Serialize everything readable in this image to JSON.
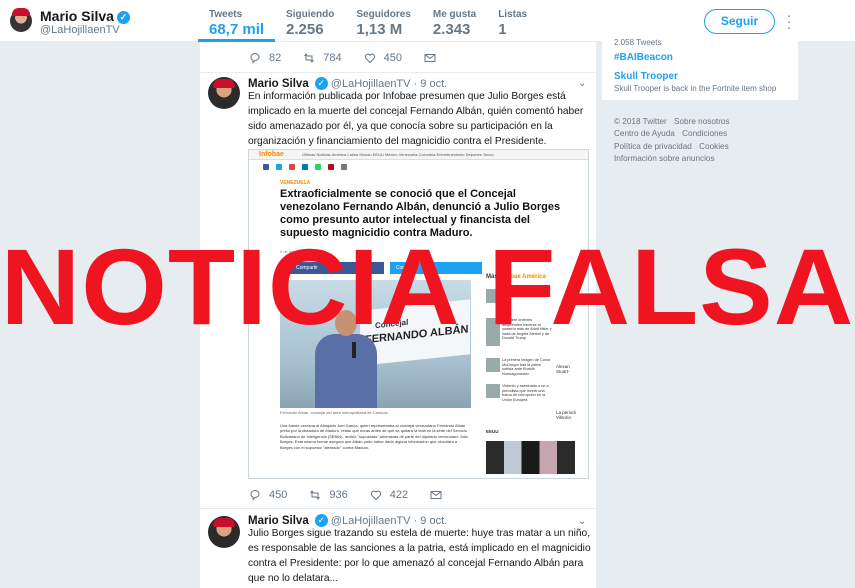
{
  "profile": {
    "name": "Mario Silva",
    "handle": "@LaHojillaenTV"
  },
  "stats": [
    {
      "label": "Tweets",
      "value": "68,7 mil",
      "active": true
    },
    {
      "label": "Siguiendo",
      "value": "2.256"
    },
    {
      "label": "Seguidores",
      "value": "1,13 M"
    },
    {
      "label": "Me gusta",
      "value": "2.343"
    },
    {
      "label": "Listas",
      "value": "1"
    }
  ],
  "follow_button": "Seguir",
  "tweet0_actions": {
    "replies": "82",
    "retweets": "784",
    "likes": "450"
  },
  "tweet1": {
    "name": "Mario Silva",
    "handle": "@LaHojillaenTV",
    "date": "· 9 oct.",
    "text": "En información publicada por Infobae presumen que Julio Borges está implicado en la muerte del concejal Fernando Albán, quién comentó haber sido amenazado por él, ya que conocía sobre su participación  en la organización y financiamiento del magnicidio contra el Presidente.",
    "actions": {
      "replies": "450",
      "retweets": "936",
      "likes": "422"
    },
    "embed": {
      "site": "Infobae",
      "menu": "Últimas Noticias   América Latina   Mundo   EEUU   México   Venezuela   Colombia   Entretenimiento   Deportes   Tecno",
      "section": "VENEZUELA",
      "headline": "Extraoficialmente se conoció que el Concejal venezolano Fernando Albán, denunció a Julio Borges como presunto autor intelectual y financista del supuesto magnicidio contra Maduro.",
      "date": "9 de octubre de 2018",
      "share_fb": "Compartir",
      "share_tw": "Compartir",
      "photo_banner_top": "Concejal",
      "photo_banner_name": "FERNANDO ALBÁN",
      "caption": "Fernando Albán, concejal del área metropolitana de Caracas",
      "body": "Una fuente cercana al Abogado Joel García, quien representaba al concejal venezolano Fernando Albán preso por la dictadura de Maduro, relató que horas antes de que se quitara la vida en la sede del Servicio Bolivariano de Inteligencia (SEBIN), recibió \"supuestas\" amenazas de parte del diputado venezolano Julio Borges. Esta misma fuente asegura que Albán pudo haber dado alguna información que vinculara a Borges con el supuesto \"atentado\" contra Maduro.",
      "sidebar_head_a": "Más",
      "sidebar_head_b": "Infobae América",
      "sidebar_items": [
        "Odón Eteak, el ...de Conor ...",
        "Las siete órdenes desprenden hacerse al sombrío más de Adolf Hitler y nada de Angela Merkel y de Donald Trump",
        "La primera imagen de Conor McGregor tras la pelea sufrida ante Khabib Nurmagomedov",
        "Violento y asesinado a un a periodista que invertí una trama de corrupción en la Unión Europea"
      ],
      "sidebar_right": [
        "Alexan Stuart-",
        "La periodi Viktoria"
      ],
      "sidebar_flag": "EEUU"
    }
  },
  "tweet2": {
    "name": "Mario Silva",
    "handle": "@LaHojillaenTV",
    "date": "· 9 oct.",
    "text": "Julio Borges sigue trazando su estela de muerte: huye tras matar a un niño, es responsable de las sanciones a la patria, está implicado en el magnicidio contra el Presidente: por lo que amenazó al concejal Fernando Albán para que no lo delatara..."
  },
  "sidebar": {
    "muted_top": "2.058 Tweets",
    "trend1": "#BAIBeacon",
    "trend2": "Skull Trooper",
    "trend2_desc": "Skull Trooper is back in the Fortnite item shop"
  },
  "footer": {
    "copyright": "© 2018 Twitter",
    "about": "Sobre nosotros",
    "help": "Centro de Ayuda",
    "terms": "Condiciones",
    "privacy": "Política de privacidad",
    "cookies": "Cookies",
    "ads": "Información sobre anuncios"
  },
  "overlay_stamp": "NOTICIA FALSA",
  "colors": {
    "accent": "#1da1f2",
    "stamp_red": "#f01420",
    "background": "#e6ecf0"
  }
}
